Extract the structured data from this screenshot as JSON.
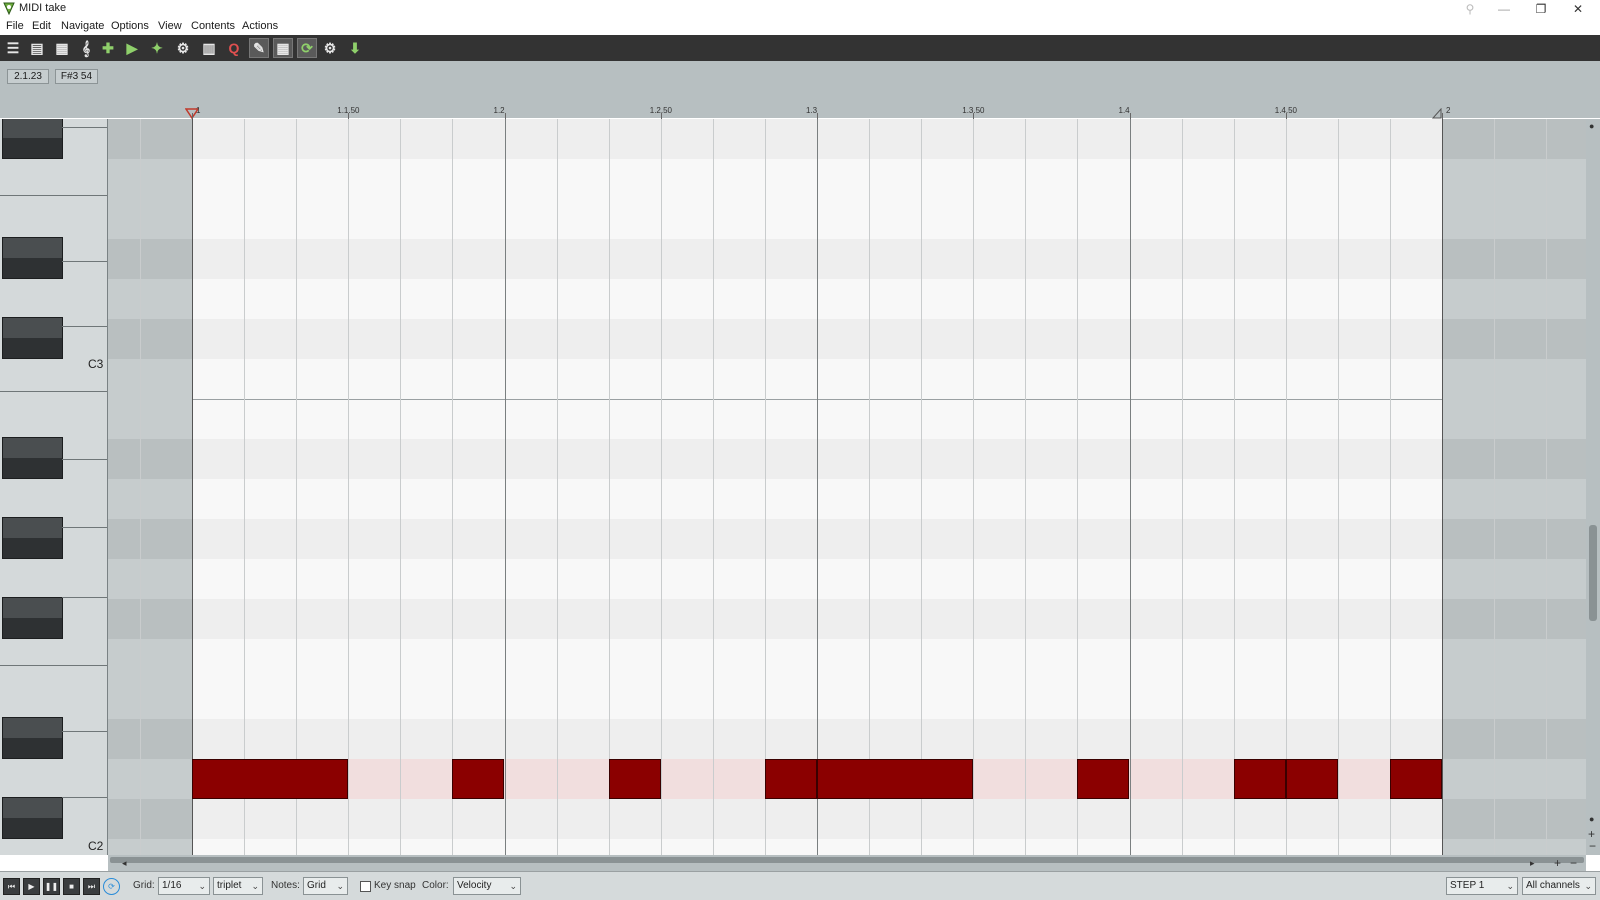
{
  "window": {
    "title": "MIDI take",
    "controls": {
      "minimize": "—",
      "maximize": "❐",
      "close": "✕"
    }
  },
  "menu": [
    "File",
    "Edit",
    "Navigate",
    "Options",
    "View",
    "Contents",
    "Actions"
  ],
  "toolbar": {
    "buttons": [
      {
        "name": "list-view-icon",
        "glyph": "☰",
        "active": false
      },
      {
        "name": "event-list-icon",
        "glyph": "▤",
        "active": false
      },
      {
        "name": "piano-roll-view-icon",
        "glyph": "▦",
        "active": false
      },
      {
        "name": "musical-notation-icon",
        "glyph": "𝄞",
        "active": false
      },
      {
        "name": "insert-note-icon",
        "glyph": "✚",
        "active": false
      },
      {
        "name": "play-from-note-icon",
        "glyph": "▶",
        "active": false
      },
      {
        "name": "add-event-icon",
        "glyph": "✦",
        "active": false
      },
      {
        "name": "select-tool-icon",
        "glyph": "⚙",
        "active": false
      },
      {
        "name": "chord-tool-icon",
        "glyph": "▥",
        "active": false
      },
      {
        "name": "quantize-icon",
        "glyph": "Q",
        "active": false
      },
      {
        "name": "draw-tool-icon",
        "glyph": "✎",
        "active": true
      },
      {
        "name": "grid-visible-icon",
        "glyph": "▦",
        "active": true
      },
      {
        "name": "loop-icon",
        "glyph": "⟳",
        "active": true
      },
      {
        "name": "step-input-icon",
        "glyph": "⚙",
        "active": false
      },
      {
        "name": "midi-input-icon",
        "glyph": "⬇",
        "active": false
      }
    ]
  },
  "info": {
    "position": "2.1.23",
    "note": "F#3 54"
  },
  "ruler": {
    "labels": [
      "1",
      "1.1.50",
      "1.2",
      "1.2.50",
      "1.3",
      "1.3.50",
      "1.4",
      "1.4.50",
      "2"
    ]
  },
  "keyboard": {
    "c3_label": "C3",
    "c2_label": "C2"
  },
  "notes": {
    "pitch": "D2",
    "start_measure_fraction": [
      0,
      0.25,
      0.375,
      0.5,
      0.5625,
      0.71875,
      0.84375,
      0.90625,
      0.96875
    ],
    "spans": [
      {
        "start": 0,
        "length": 0.125
      },
      {
        "start": 0.208333,
        "length": 0.041667
      },
      {
        "start": 0.333333,
        "length": 0.041667
      },
      {
        "start": 0.458333,
        "length": 0.041667
      },
      {
        "start": 0.5,
        "length": 0.125
      },
      {
        "start": 0.708333,
        "length": 0.041667
      },
      {
        "start": 0.833333,
        "length": 0.041667
      },
      {
        "start": 0.875,
        "length": 0.041667
      },
      {
        "start": 0.958333,
        "length": 0.041667
      }
    ]
  },
  "transport": {
    "grid_label": "Grid:",
    "grid_value": "1/16",
    "grid_type": "triplet",
    "notes_label": "Notes:",
    "notes_value": "Grid",
    "keysnap_label": "Key snap",
    "color_label": "Color:",
    "color_value": "Velocity",
    "step_value": "STEP 1",
    "channel_value": "All channels"
  },
  "colors": {
    "note": "#8b0000",
    "toolbar": "#333333",
    "background": "#b7bfc1"
  }
}
